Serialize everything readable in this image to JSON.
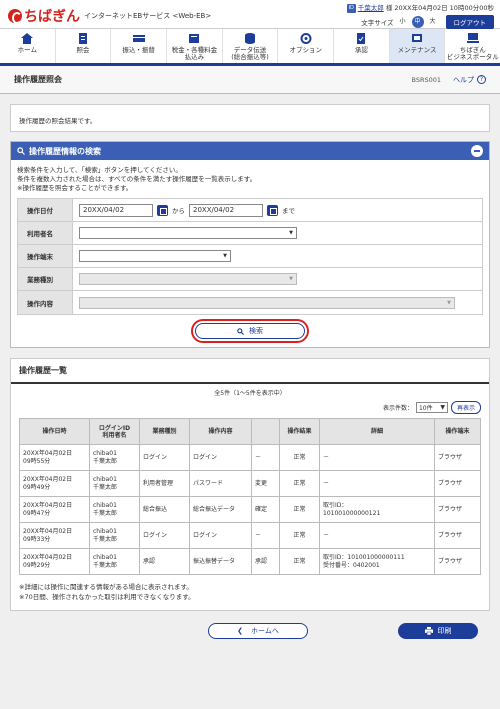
{
  "header": {
    "logo_text": "ちばぎん",
    "service_name": "インターネットEBサービス <Web-EB>",
    "user_name": "千葉太郎",
    "user_suffix": "様",
    "last_login": "20XX年04月02日 10時00分00秒",
    "font_size_label": "文字サイズ",
    "font_sizes": [
      "小",
      "中",
      "大"
    ],
    "logout": "ログアウト"
  },
  "nav": [
    {
      "label": "ホーム",
      "icon": "home-icon"
    },
    {
      "label": "照会",
      "icon": "inquiry-icon"
    },
    {
      "label": "振込・振替",
      "icon": "transfer-icon"
    },
    {
      "label": "税金・各種料金\n払込み",
      "icon": "tax-payment-icon"
    },
    {
      "label": "データ伝送\n(総合振込等)",
      "icon": "data-transmission-icon"
    },
    {
      "label": "オプション",
      "icon": "option-icon"
    },
    {
      "label": "承認",
      "icon": "approval-icon"
    },
    {
      "label": "メンテナンス",
      "icon": "maintenance-icon"
    },
    {
      "label": "ちばぎん\nビジネスポータル",
      "icon": "portal-icon"
    }
  ],
  "page": {
    "title": "操作履歴照会",
    "screen_id": "BSRS001",
    "help": "ヘルプ"
  },
  "intro": "操作履歴の照会結果です。",
  "search_panel": {
    "title": "操作履歴情報の検索",
    "desc": [
      "検索条件を入力して、「検索」ボタンを押してください。",
      "条件を複数入力された場合は、すべての条件を満たす操作履歴を一覧表示します。",
      "※操作履歴を照会することができます。"
    ],
    "fields": {
      "date_label": "操作日付",
      "date_from": "20XX/04/02",
      "date_sep": "から",
      "date_to": "20XX/04/02",
      "date_end": "まで",
      "user_label": "利用者名",
      "terminal_label": "操作端末",
      "business_label": "業務種別",
      "operation_label": "操作内容"
    },
    "search_button": "検索"
  },
  "results": {
    "title": "操作履歴一覧",
    "count": "全5件（1～5件を表示中）",
    "per_page_label": "表示件数：",
    "per_page_value": "10件",
    "redisplay": "再表示",
    "columns": [
      "操作日時",
      "ログインID\n利用者名",
      "業務種別",
      "操作内容",
      "",
      "操作結果",
      "詳細",
      "操作端末"
    ],
    "rows": [
      {
        "datetime": [
          "20XX年04月02日",
          "09時55分"
        ],
        "user": [
          "chiba01",
          "千葉太郎"
        ],
        "business": "ログイン",
        "operation": "ログイン",
        "sub": "－",
        "result": "正常",
        "detail": [
          "－"
        ],
        "terminal": "ブラウザ"
      },
      {
        "datetime": [
          "20XX年04月02日",
          "09時49分"
        ],
        "user": [
          "chiba01",
          "千葉太郎"
        ],
        "business": "利用者管理",
        "operation": "パスワード",
        "sub": "変更",
        "result": "正常",
        "detail": [
          "－"
        ],
        "terminal": "ブラウザ"
      },
      {
        "datetime": [
          "20XX年04月02日",
          "09時47分"
        ],
        "user": [
          "chiba01",
          "千葉太郎"
        ],
        "business": "総合振込",
        "operation": "総合振込データ",
        "sub": "確定",
        "result": "正常",
        "detail": [
          "取引ID：",
          "101001000000121"
        ],
        "terminal": "ブラウザ"
      },
      {
        "datetime": [
          "20XX年04月02日",
          "09時33分"
        ],
        "user": [
          "chiba01",
          "千葉太郎"
        ],
        "business": "ログイン",
        "operation": "ログイン",
        "sub": "－",
        "result": "正常",
        "detail": [
          "－"
        ],
        "terminal": "ブラウザ"
      },
      {
        "datetime": [
          "20XX年04月02日",
          "09時29分"
        ],
        "user": [
          "chiba01",
          "千葉太郎"
        ],
        "business": "承認",
        "operation": "振込振替データ",
        "sub": "承認",
        "result": "正常",
        "detail": [
          "取引ID：101001000000111",
          "受付番号：0402001"
        ],
        "terminal": "ブラウザ"
      }
    ],
    "notes": [
      "※詳細には操作に関連する情報がある場合に表示されます。",
      "※70日間、操作されなかった取引は利用できなくなります。"
    ]
  },
  "bottom": {
    "home_button": "ホームへ",
    "print_button": "印刷"
  }
}
